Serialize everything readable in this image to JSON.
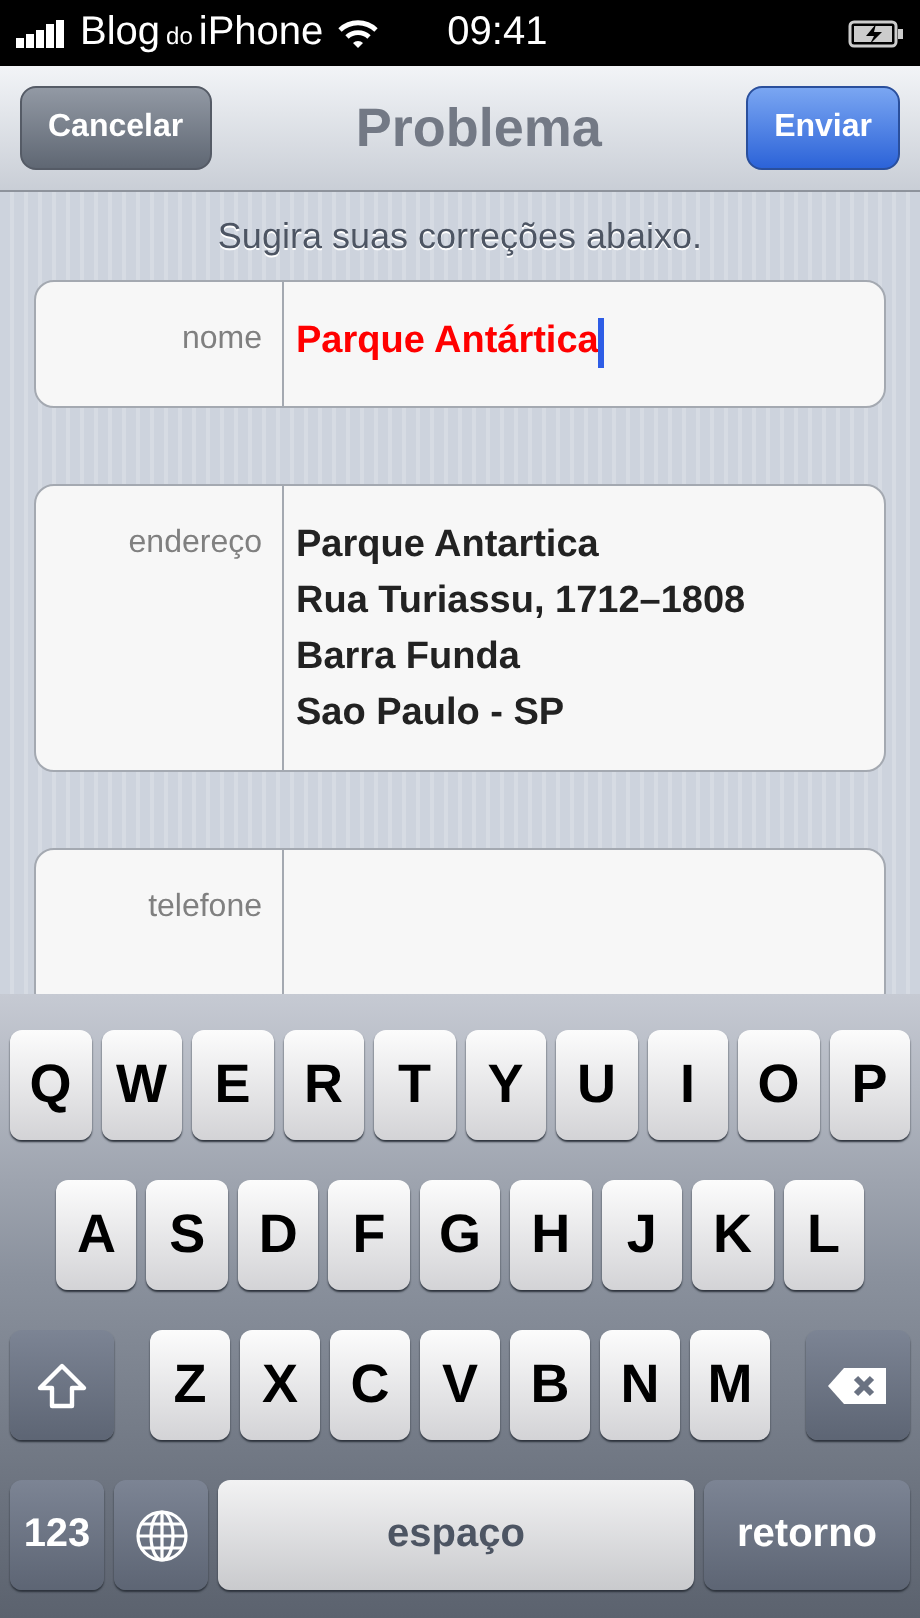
{
  "status_bar": {
    "carrier": [
      {
        "text": "Blog",
        "kind": "normal"
      },
      {
        "text": "do",
        "kind": "small"
      },
      {
        "text": "iPhone",
        "kind": "normal"
      }
    ],
    "time": "09:41"
  },
  "nav_bar": {
    "left_button": "Cancelar",
    "title": "Problema",
    "right_button": "Enviar"
  },
  "hint": "Sugira suas correções abaixo.",
  "fields": [
    {
      "label": "nome",
      "lines": [
        "Parque Antártica"
      ],
      "focused": true
    },
    {
      "label": "endereço",
      "lines": [
        "Parque Antartica",
        "Rua Turiassu, 1712–1808",
        "Barra Funda",
        "Sao Paulo - SP"
      ],
      "focused": false
    },
    {
      "label": "telefone",
      "focused": false
    }
  ],
  "keyboard": {
    "letter_rows": [
      {
        "keys": [
          "Q",
          "W",
          "E",
          "R",
          "T",
          "Y",
          "U",
          "I",
          "O",
          "P"
        ]
      },
      {
        "keys": [
          "A",
          "S",
          "D",
          "F",
          "G",
          "H",
          "J",
          "K",
          "L"
        ]
      },
      {
        "keys": [
          "Z",
          "X",
          "C",
          "V",
          "B",
          "N",
          "M"
        ]
      }
    ],
    "numbers_key": "123",
    "space_key": "espaço",
    "return_key": "retorno"
  }
}
